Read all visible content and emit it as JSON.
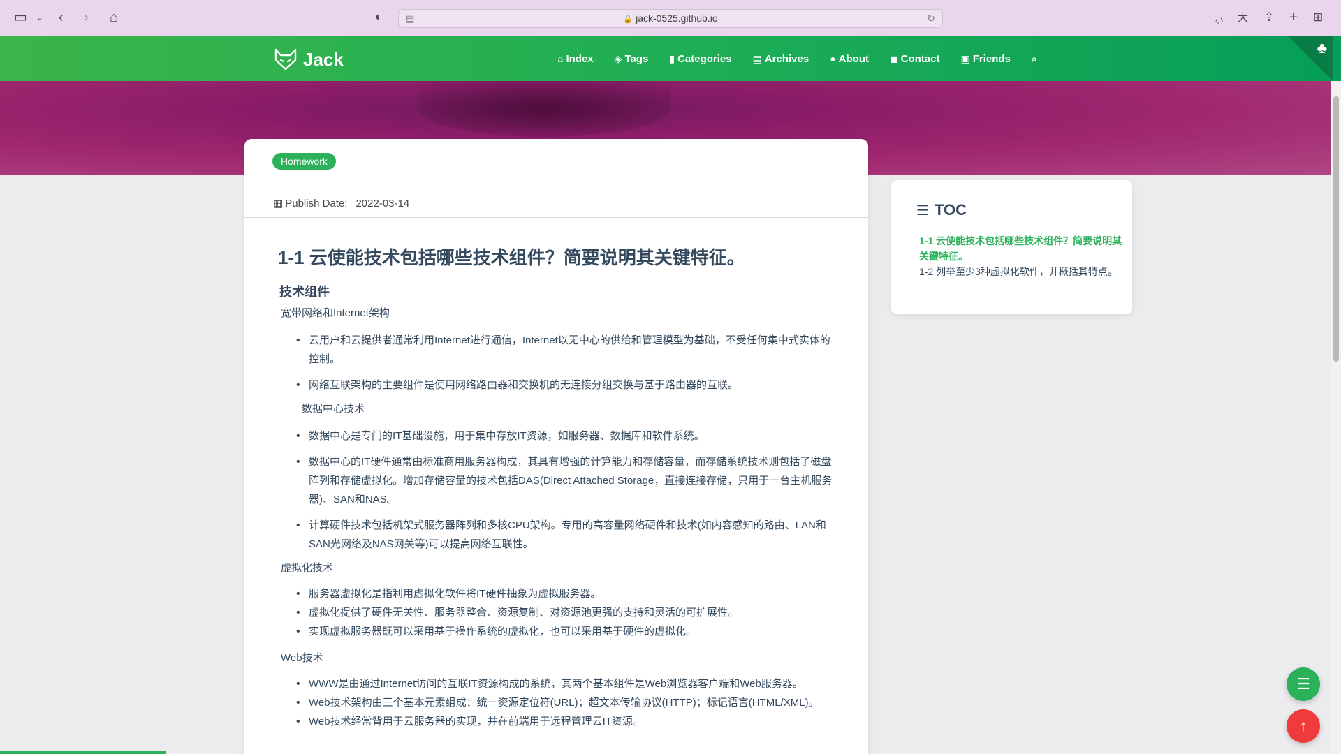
{
  "browser": {
    "url": "jack-0525.github.io",
    "icons": [
      "sidebar-icon",
      "chevron-down-icon",
      "back-icon",
      "forward-icon",
      "home-icon",
      "shield-icon",
      "reload-icon",
      "text-small-icon",
      "text-large-icon",
      "share-icon",
      "new-tab-icon",
      "tab-overview-icon"
    ],
    "text_small": "小",
    "text_large": "大"
  },
  "site": {
    "brand": "Jack",
    "nav": [
      {
        "label": "Index",
        "icon": "home-icon"
      },
      {
        "label": "Tags",
        "icon": "tags-icon"
      },
      {
        "label": "Categories",
        "icon": "bookmark-icon"
      },
      {
        "label": "Archives",
        "icon": "archive-icon"
      },
      {
        "label": "About",
        "icon": "user-circle-icon"
      },
      {
        "label": "Contact",
        "icon": "comments-icon"
      },
      {
        "label": "Friends",
        "icon": "address-book-icon"
      }
    ],
    "search_icon": "search-icon",
    "accent": "#2bb159"
  },
  "post": {
    "tag": "Homework",
    "publish_label": "Publish Date:",
    "publish_date": "2022-03-14",
    "title": "1-1 云使能技术包括哪些技术组件？简要说明其关键特征。",
    "section_heading": "技术组件",
    "s1_title": "宽带网络和Internet架构",
    "s1_items": [
      "云用户和云提供者通常利用Internet进行通信，Internet以无中心的供给和管理模型为基础，不受任何集中式实体的控制。",
      "网络互联架构的主要组件是使用网络路由器和交换机的无连接分组交换与基于路由器的互联。"
    ],
    "s2_title": "数据中心技术",
    "s2_items": [
      "数据中心是专门的IT基础设施，用于集中存放IT资源，如服务器、数据库和软件系统。",
      "数据中心的IT硬件通常由标准商用服务器构成，其具有增强的计算能力和存储容量，而存储系统技术则包括了磁盘阵列和存储虚拟化。增加存储容量的技术包括DAS(Direct Attached Storage，直接连接存储，只用于一台主机服务器)、SAN和NAS。",
      "计算硬件技术包括机架式服务器阵列和多核CPU架构。专用的高容量网络硬件和技术(如内容感知的路由、LAN和SAN光网络及NAS网关等)可以提高网络互联性。"
    ],
    "s3_title": "虚拟化技术",
    "s3_items": [
      "服务器虚拟化是指利用虚拟化软件将IT硬件抽象为虚拟服务器。",
      "虚拟化提供了硬件无关性、服务器整合、资源复制、对资源池更强的支持和灵活的可扩展性。",
      "实现虚拟服务器既可以采用基于操作系统的虚拟化，也可以采用基于硬件的虚拟化。"
    ],
    "s4_title": "Web技术",
    "s4_items": [
      "WWW是由通过Internet访问的互联IT资源构成的系统，其两个基本组件是Web浏览器客户端和Web服务器。",
      "Web技术架构由三个基本元素组成：统一资源定位符(URL)；超文本传输协议(HTTP)；标记语言(HTML/XML)。",
      "Web技术经常背用于云服务器的实现，并在前端用于远程管理云IT资源。"
    ]
  },
  "toc": {
    "title": "TOC",
    "items": [
      {
        "label": "1-1 云使能技术包括哪些技术组件？简要说明其关键特征。",
        "active": true
      },
      {
        "label": "1-2 列举至少3种虚拟化软件，并概括其特点。",
        "active": false
      }
    ]
  }
}
